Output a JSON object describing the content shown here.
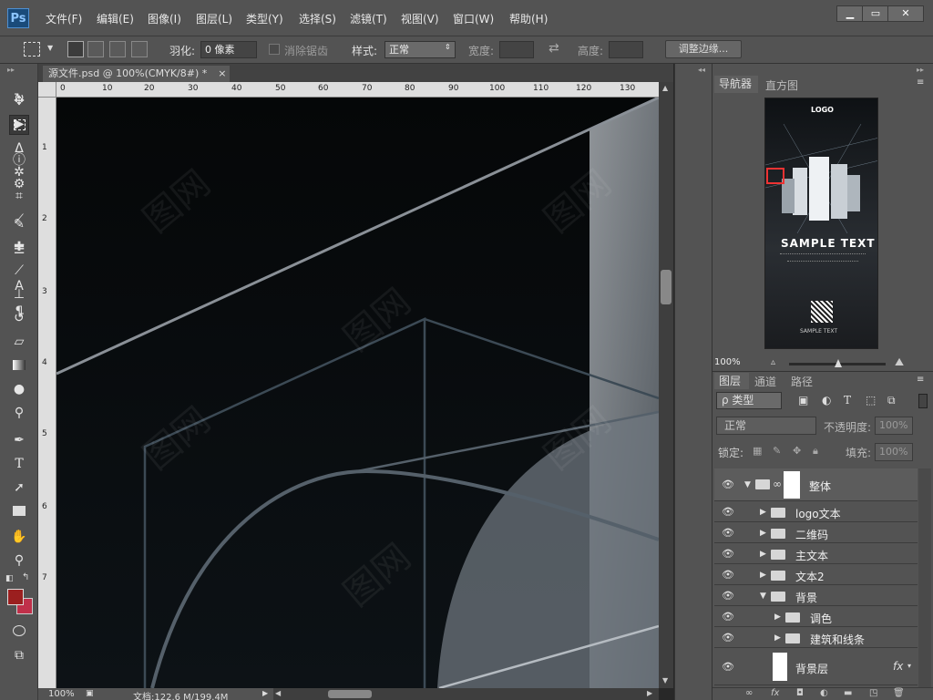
{
  "menu": {
    "logo": "Ps",
    "items": [
      "文件(F)",
      "编辑(E)",
      "图像(I)",
      "图层(L)",
      "类型(Y)",
      "选择(S)",
      "滤镜(T)",
      "视图(V)",
      "窗口(W)",
      "帮助(H)"
    ],
    "minimize": "▁",
    "maximize": "▭",
    "close": "✕"
  },
  "options": {
    "feather_label": "羽化:",
    "feather_value": "0 像素",
    "antialias_label": "消除锯齿",
    "style_label": "样式:",
    "style_value": "正常",
    "width_label": "宽度:",
    "height_label": "高度:",
    "refine_edge": "调整边缘..."
  },
  "document": {
    "tab_title": "源文件.psd @ 100%(CMYK/8#) *",
    "tab_close": "×",
    "ruler_h": [
      "0",
      "10",
      "20",
      "30",
      "40",
      "50",
      "60",
      "70",
      "80",
      "90",
      "100",
      "110",
      "120",
      "130"
    ],
    "ruler_v": [
      "1",
      "2",
      "3",
      "4",
      "5",
      "6",
      "7"
    ],
    "zoom": "100%",
    "doc_size": "文档:122.6 M/199.4M"
  },
  "navigator": {
    "tab_active": "导航器",
    "tab_other": "直方图",
    "zoom": "100%",
    "thumb_logo": "LOGO",
    "thumb_title": "SAMPLE TEXT",
    "thumb_footer": "SAMPLE TEXT"
  },
  "layers": {
    "tabs": [
      "图层",
      "通道",
      "路径"
    ],
    "filter_label": "ρ 类型",
    "blend_mode": "正常",
    "opacity_label": "不透明度:",
    "opacity_value": "100%",
    "lock_label": "锁定:",
    "fill_label": "填充:",
    "fill_value": "100%",
    "rows": [
      "整体",
      "logo文本",
      "二维码",
      "主文本",
      "文本2",
      "背景",
      "调色",
      "建筑和线条",
      "背景层"
    ],
    "fx": "fx"
  },
  "colors": {
    "foreground": "#9b1f1f",
    "background": "#c0304a",
    "accent": "#4f8fd0"
  }
}
